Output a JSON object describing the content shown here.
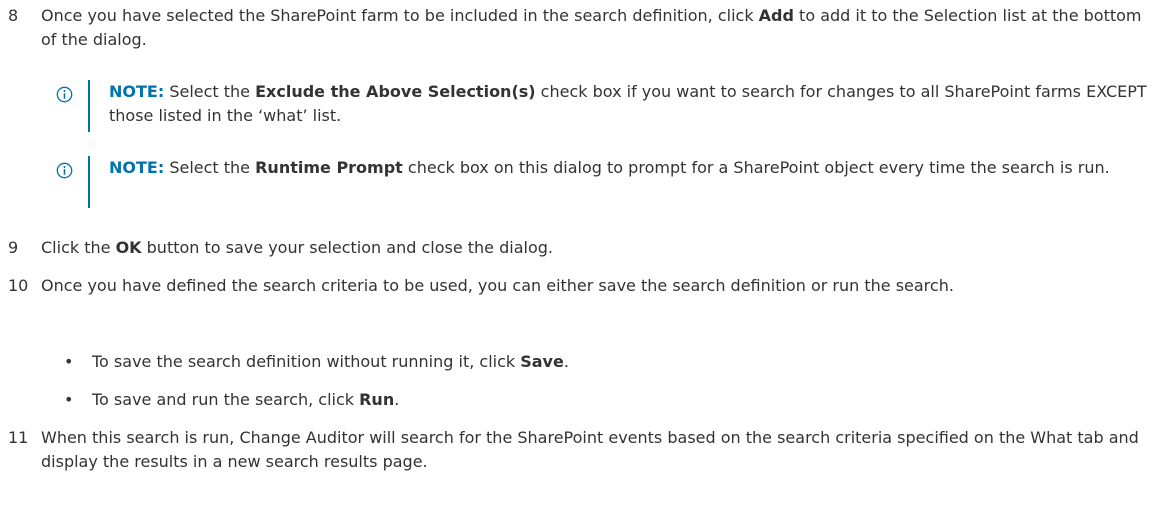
{
  "steps": [
    {
      "num": "8",
      "a": "Once you have selected the SharePoint farm to be included in the search definition, click ",
      "b": "Add",
      "c": " to add it to the Selection list at the bottom of the dialog."
    },
    {
      "num": "9",
      "a": "Click the ",
      "b": "OK",
      "c": " button to save your selection and close the dialog."
    },
    {
      "num": "10",
      "a": "Once you have defined the search criteria to be used, you can either save the search definition or run the search."
    },
    {
      "num": "11",
      "a": "When this search is run, Change Auditor will search for the SharePoint events based on the search criteria specified on the What tab and display the results in a new search results page."
    }
  ],
  "notes": [
    {
      "label": "NOTE:",
      "a": " Select the ",
      "b": "Exclude the Above Selection(s)",
      "c": " check box if you want to search for changes to all SharePoint farms EXCEPT those listed in the ‘what’ list."
    },
    {
      "label": "NOTE:",
      "a": " Select the ",
      "b": "Runtime Prompt",
      "c": " check box on this dialog to prompt for a SharePoint object every time the search is run."
    }
  ],
  "bullets": [
    {
      "dot": "•",
      "a": "To save the search definition without running it, click ",
      "b": "Save",
      "c": "."
    },
    {
      "dot": "•",
      "a": "To save and run the search, click ",
      "b": "Run",
      "c": "."
    }
  ],
  "colors": {
    "note_accent": "#0073aa",
    "text": "#333333"
  },
  "icons": {
    "note": "info-circle-icon"
  }
}
